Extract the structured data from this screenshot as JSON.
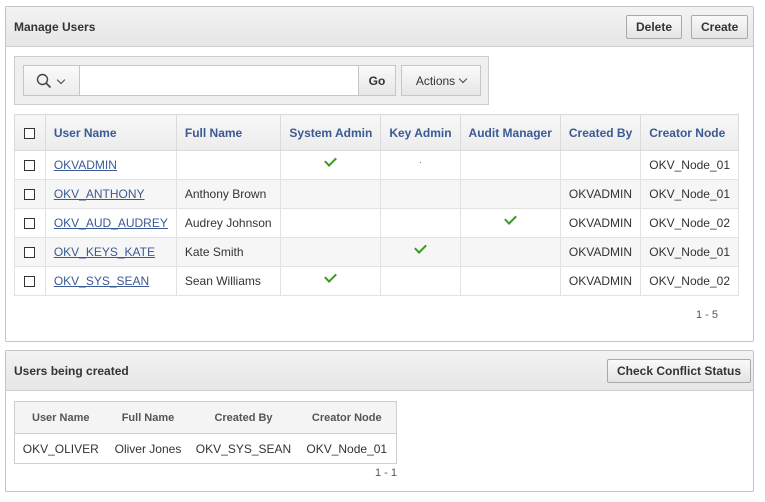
{
  "manage_users": {
    "title": "Manage Users",
    "delete_label": "Delete",
    "create_label": "Create",
    "search": {
      "value": "",
      "placeholder": "",
      "go_label": "Go",
      "actions_label": "Actions"
    },
    "columns": [
      "User Name",
      "Full Name",
      "System Admin",
      "Key Admin",
      "Audit Manager",
      "Created By",
      "Creator Node"
    ],
    "rows": [
      {
        "user_name": "OKVADMIN",
        "full_name": "",
        "system_admin": true,
        "key_admin": false,
        "audit_manager": false,
        "created_by": "",
        "creator_node": "OKV_Node_01"
      },
      {
        "user_name": "OKV_ANTHONY",
        "full_name": "Anthony Brown",
        "system_admin": false,
        "key_admin": false,
        "audit_manager": false,
        "created_by": "OKVADMIN",
        "creator_node": "OKV_Node_01"
      },
      {
        "user_name": "OKV_AUD_AUDREY",
        "full_name": "Audrey Johnson",
        "system_admin": false,
        "key_admin": false,
        "audit_manager": true,
        "created_by": "OKVADMIN",
        "creator_node": "OKV_Node_02"
      },
      {
        "user_name": "OKV_KEYS_KATE",
        "full_name": "Kate Smith",
        "system_admin": false,
        "key_admin": true,
        "audit_manager": false,
        "created_by": "OKVADMIN",
        "creator_node": "OKV_Node_01"
      },
      {
        "user_name": "OKV_SYS_SEAN",
        "full_name": "Sean Williams",
        "system_admin": true,
        "key_admin": false,
        "audit_manager": false,
        "created_by": "OKVADMIN",
        "creator_node": "OKV_Node_02"
      }
    ],
    "pagination": "1 - 5"
  },
  "users_being_created": {
    "title": "Users being created",
    "check_conflict_label": "Check Conflict Status",
    "columns": [
      "User Name",
      "Full Name",
      "Created By",
      "Creator Node"
    ],
    "rows": [
      {
        "user_name": "OKV_OLIVER",
        "full_name": "Oliver Jones",
        "created_by": "OKV_SYS_SEAN",
        "creator_node": "OKV_Node_01"
      }
    ],
    "pagination": "1 - 1"
  },
  "icons": {
    "search": "search-icon",
    "dropdown": "chevron-down-icon",
    "checkmark": "checkmark-icon",
    "checkbox": "checkbox"
  },
  "colors": {
    "link": "#3a5a94",
    "check": "#3c9a1e"
  }
}
